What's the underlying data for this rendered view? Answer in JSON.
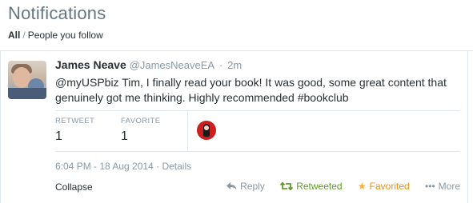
{
  "header": {
    "title": "Notifications",
    "filter_all": "All",
    "filter_separator": "/",
    "filter_following": "People you follow"
  },
  "tweet": {
    "name": "James Neave",
    "handle": "@JamesNeaveEA",
    "separator": "·",
    "time": "2m",
    "text": "@myUSPbiz Tim, I finally read your book!  It was good, some great content that genuinely got me thinking.  Highly recommended #bookclub",
    "stats": {
      "retweet_label": "RETWEET",
      "retweet_count": "1",
      "favorite_label": "FAVORITE",
      "favorite_count": "1"
    },
    "timestamp": "6:04 PM - 18 Aug 2014",
    "meta_separator": "·",
    "details_label": "Details",
    "collapse_label": "Collapse",
    "actions": {
      "reply": "Reply",
      "retweeted": "Retweeted",
      "favorited": "Favorited",
      "more": "More"
    }
  },
  "colors": {
    "retweeted": "#609928",
    "favorited": "#e89016",
    "muted": "#8899a6"
  },
  "icons": {
    "reply": "reply-icon",
    "retweet": "retweet-icon",
    "favorite": "star-icon",
    "more": "more-icon"
  }
}
